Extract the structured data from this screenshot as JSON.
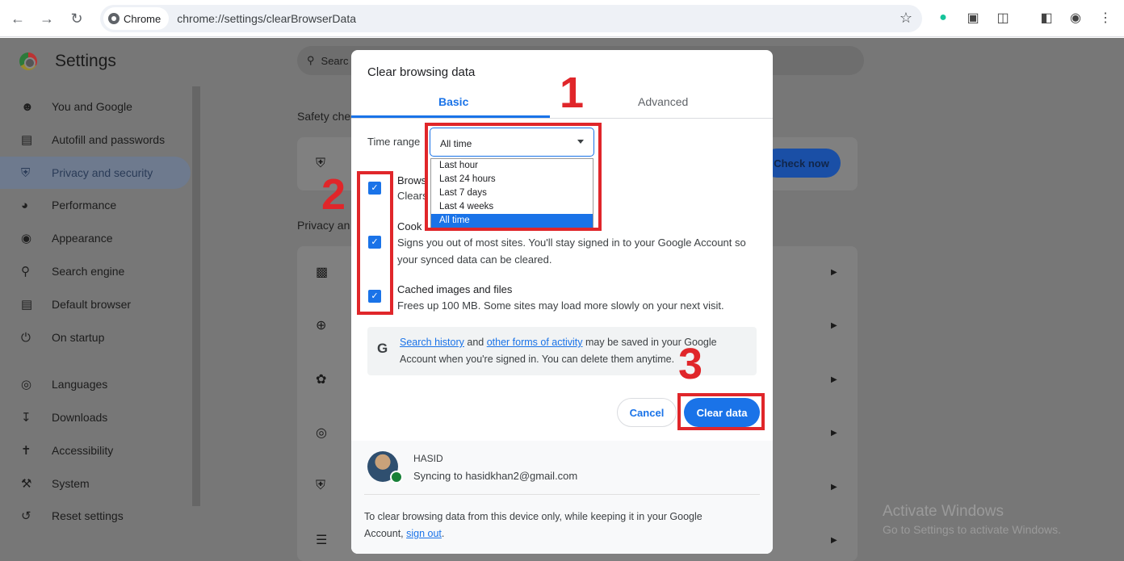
{
  "browser": {
    "chip_label": "Chrome",
    "url": "chrome://settings/clearBrowserData"
  },
  "sidebar": {
    "title": "Settings",
    "items": [
      {
        "label": "You and Google",
        "icon": "person-icon"
      },
      {
        "label": "Autofill and passwords",
        "icon": "clipboard-icon"
      },
      {
        "label": "Privacy and security",
        "icon": "shield-icon",
        "active": true
      },
      {
        "label": "Performance",
        "icon": "speedometer-icon"
      },
      {
        "label": "Appearance",
        "icon": "palette-icon"
      },
      {
        "label": "Search engine",
        "icon": "search-icon"
      },
      {
        "label": "Default browser",
        "icon": "browser-icon"
      },
      {
        "label": "On startup",
        "icon": "power-icon"
      },
      {
        "label": "Languages",
        "icon": "globe-icon"
      },
      {
        "label": "Downloads",
        "icon": "download-icon"
      },
      {
        "label": "Accessibility",
        "icon": "accessibility-icon"
      },
      {
        "label": "System",
        "icon": "wrench-icon"
      },
      {
        "label": "Reset settings",
        "icon": "reset-icon"
      }
    ]
  },
  "main": {
    "search_placeholder": "Searc",
    "safety_label": "Safety che",
    "privacy_label": "Privacy an",
    "check_now": "Check now",
    "watermark_title": "Activate Windows",
    "watermark_sub": "Go to Settings to activate Windows."
  },
  "dialog": {
    "title": "Clear browsing data",
    "tabs": {
      "basic": "Basic",
      "advanced": "Advanced"
    },
    "time_range_label": "Time range",
    "time_range_value": "All time",
    "time_range_options": [
      "Last hour",
      "Last 24 hours",
      "Last 7 days",
      "Last 4 weeks",
      "All time"
    ],
    "items": [
      {
        "title": "Brows",
        "desc": "Clears",
        "checked": true
      },
      {
        "title": "Cook",
        "desc": "Signs you out of most sites. You'll stay signed in to your Google Account so your synced data can be cleared.",
        "checked": true
      },
      {
        "title": "Cached images and files",
        "desc": "Frees up 100 MB. Some sites may load more slowly on your next visit.",
        "checked": true
      }
    ],
    "note": {
      "link1": "Search history",
      "mid": " and ",
      "link2": "other forms of activity",
      "rest": " may be saved in your Google Account when you're signed in. You can delete them anytime."
    },
    "cancel": "Cancel",
    "clear": "Clear data",
    "account": {
      "name": "HASID",
      "sync": "Syncing to hasidkhan2@gmail.com"
    },
    "footer_text": "To clear browsing data from this device only, while keeping it in your Google Account, ",
    "footer_link": "sign out",
    "footer_end": "."
  },
  "annotations": {
    "n1": "1",
    "n2": "2",
    "n3": "3"
  },
  "colors": {
    "accent": "#1a73e8",
    "highlight": "#e0262a"
  }
}
